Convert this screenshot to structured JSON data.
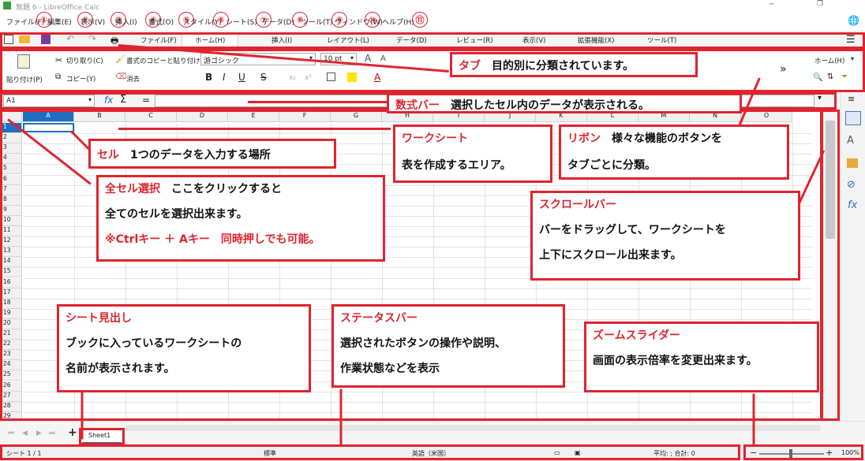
{
  "window": {
    "title": "無題 6 - LibreOffice Calc"
  },
  "menu": [
    {
      "label": "ファイル(F)",
      "num": "①"
    },
    {
      "label": "編集(E)",
      "num": "②"
    },
    {
      "label": "表示(V)",
      "num": "③"
    },
    {
      "label": "挿入(I)",
      "num": "④"
    },
    {
      "label": "書式(O)",
      "num": "⑤"
    },
    {
      "label": "スタイル(Y)",
      "num": "⑥"
    },
    {
      "label": "シート(S)",
      "num": "⑦"
    },
    {
      "label": "データ(D)",
      "num": "⑧"
    },
    {
      "label": "ツール(T)",
      "num": "⑨"
    },
    {
      "label": "ウィンドウ(W)",
      "num": "⑩"
    },
    {
      "label": "ヘルプ(H)",
      "num": "⑪"
    }
  ],
  "tabs": [
    "ファイル(F)",
    "ホーム(H)",
    "挿入(I)",
    "レイアウト(L)",
    "データ(D)",
    "レビュー(R)",
    "表示(V)",
    "拡張機能(X)",
    "ツール(T)"
  ],
  "ribbon": {
    "paste": "貼り付け(P)",
    "cut": "切り取り(C)",
    "copy": "コピー(Y)",
    "clone": "書式のコピーと貼り付け",
    "clear": "消去",
    "font": "游ゴシック",
    "size": "10 pt",
    "bold": "B",
    "italic": "I",
    "underline": "U",
    "strike": "S",
    "home_menu": "ホーム(H)",
    "more": "»"
  },
  "formula": {
    "namebox": "A1",
    "fx": "fx",
    "sigma": "Σ",
    "eq": "="
  },
  "columns": [
    "A",
    "B",
    "C",
    "D",
    "E",
    "F",
    "G",
    "H",
    "I",
    "J",
    "K",
    "L",
    "M",
    "N",
    "O"
  ],
  "rows": [
    "1",
    "2",
    "3",
    "4",
    "5",
    "6",
    "7",
    "8",
    "9",
    "10",
    "11",
    "12",
    "13",
    "14",
    "15",
    "16",
    "17",
    "18",
    "19",
    "20",
    "21",
    "22",
    "23",
    "24",
    "25",
    "26",
    "27",
    "28",
    "29"
  ],
  "sheet_tab": "Sheet1",
  "status": {
    "sheet": "シート 1 / 1",
    "style": "標準",
    "lang": "英語（米国）",
    "sum": "平均: ; 合計: 0",
    "zoom": "100%"
  },
  "callouts": {
    "tab": {
      "title": "タブ",
      "text": "目的別に分類されています。"
    },
    "formula": {
      "title": "数式バー",
      "text": "選択したセル内のデータが表示される。"
    },
    "cell": {
      "title": "セル",
      "text": "1つのデータを入力する場所"
    },
    "worksheet": {
      "title": "ワークシート",
      "text": "表を作成するエリア。"
    },
    "ribbon": {
      "title": "リボン",
      "text1": "様々な機能のボタンを",
      "text2": "タブごとに分類。"
    },
    "selectall": {
      "title": "全セル選択",
      "text1": "ここをクリックすると",
      "text2": "全てのセルを選択出来ます。",
      "text3": "※Ctrlキー ＋ Aキー　同時押しでも可能。"
    },
    "scrollbar": {
      "title": "スクロールバー",
      "text1": "バーをドラッグして、ワークシートを",
      "text2": "上下にスクロール出来ます。"
    },
    "sheettab": {
      "title": "シート見出し",
      "text1": "ブックに入っているワークシートの",
      "text2": "名前が表示されます。"
    },
    "statusbar": {
      "title": "ステータスバー",
      "text1": "選択されたボタンの操作や説明、",
      "text2": "作業状態などを表示"
    },
    "zoom": {
      "title": "ズームスライダー",
      "text": "画面の表示倍率を変更出来ます。"
    }
  }
}
